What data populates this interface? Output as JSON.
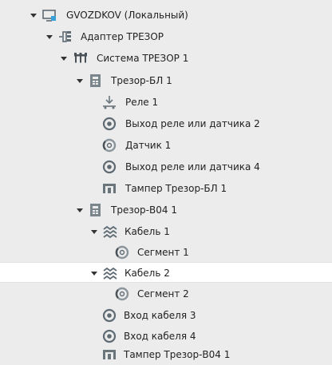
{
  "tree": {
    "nodes": [
      {
        "label": "GVOZDKOV (Локальный)",
        "icon": "computer-icon",
        "expanded": true
      },
      {
        "label": "Адаптер ТРЕЗОР",
        "icon": "adapter-icon",
        "expanded": true
      },
      {
        "label": "Система ТРЕЗОР 1",
        "icon": "system-icon",
        "expanded": true
      },
      {
        "label": "Трезор-БЛ 1",
        "icon": "device-block-icon",
        "expanded": true
      },
      {
        "label": "Реле 1",
        "icon": "relay-icon"
      },
      {
        "label": "Выход реле или датчика 2",
        "icon": "output-icon"
      },
      {
        "label": "Датчик 1",
        "icon": "sensor-icon"
      },
      {
        "label": "Выход реле или датчика 4",
        "icon": "output-icon"
      },
      {
        "label": "Тампер Трезор-БЛ 1",
        "icon": "tamper-icon"
      },
      {
        "label": "Трезор-В04 1",
        "icon": "device-block-icon",
        "expanded": true
      },
      {
        "label": "Кабель 1",
        "icon": "cable-icon",
        "expanded": true
      },
      {
        "label": "Сегмент 1",
        "icon": "segment-icon"
      },
      {
        "label": "Кабель 2",
        "icon": "cable-icon",
        "expanded": true,
        "selected": true
      },
      {
        "label": "Сегмент 2",
        "icon": "segment-icon"
      },
      {
        "label": "Вход кабеля 3",
        "icon": "output-icon"
      },
      {
        "label": "Вход кабеля 4",
        "icon": "output-icon"
      },
      {
        "label": "Тампер Трезор-В04 1",
        "icon": "tamper-icon"
      }
    ]
  },
  "colors": {
    "background": "#ececec",
    "selected_row": "#ffffff",
    "text": "#222222",
    "icon_gray": "#5f6b73"
  }
}
